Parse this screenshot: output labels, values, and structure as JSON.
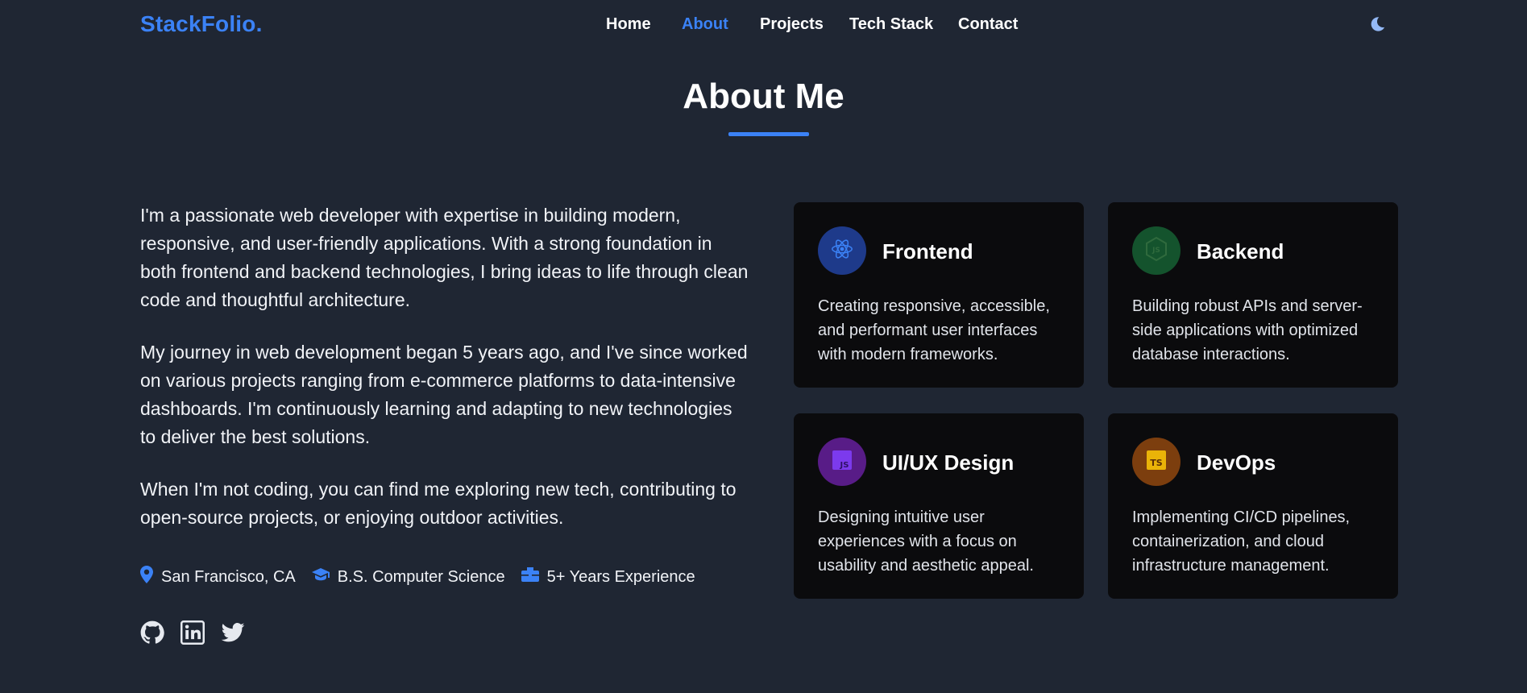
{
  "brand": "StackFolio.",
  "nav": [
    {
      "label": "Home",
      "active": false
    },
    {
      "label": "About",
      "active": true
    },
    {
      "label": "Projects",
      "active": false
    },
    {
      "label": "Tech Stack",
      "active": false
    },
    {
      "label": "Contact",
      "active": false
    }
  ],
  "theme_toggle_icon": "moon-icon",
  "section": {
    "title": "About Me"
  },
  "about": {
    "paragraphs": [
      "I'm a passionate web developer with expertise in building modern, responsive, and user-friendly applications. With a strong foundation in both frontend and backend technologies, I bring ideas to life through clean code and thoughtful architecture.",
      "My journey in web development began 5 years ago, and I've since worked on various projects ranging from e-commerce platforms to data-intensive dashboards. I'm continuously learning and adapting to new technologies to deliver the best solutions.",
      "When I'm not coding, you can find me exploring new tech, contributing to open-source projects, or enjoying outdoor activities."
    ],
    "meta": [
      {
        "icon": "location-pin-icon",
        "text": "San Francisco, CA"
      },
      {
        "icon": "graduation-cap-icon",
        "text": "B.S. Computer Science"
      },
      {
        "icon": "briefcase-icon",
        "text": "5+ Years Experience"
      }
    ],
    "socials": [
      {
        "icon": "github-icon"
      },
      {
        "icon": "linkedin-icon"
      },
      {
        "icon": "twitter-icon"
      }
    ]
  },
  "cards": [
    {
      "title": "Frontend",
      "description": "Creating responsive, accessible, and performant user interfaces with modern frameworks.",
      "icon": "react-icon",
      "color": "#1e3a8a"
    },
    {
      "title": "Backend",
      "description": "Building robust APIs and server-side applications with optimized database interactions.",
      "icon": "nodejs-icon",
      "color": "#14532d"
    },
    {
      "title": "UI/UX Design",
      "description": "Designing intuitive user experiences with a focus on usability and aesthetic appeal.",
      "icon": "js-icon",
      "color": "#581c87"
    },
    {
      "title": "DevOps",
      "description": "Implementing CI/CD pipelines, containerization, and cloud infrastructure management.",
      "icon": "ts-icon",
      "color": "#7c3e0e"
    }
  ],
  "colors": {
    "accent": "#3b82f6",
    "background": "#1f2633",
    "card": "#0b0b0d"
  }
}
